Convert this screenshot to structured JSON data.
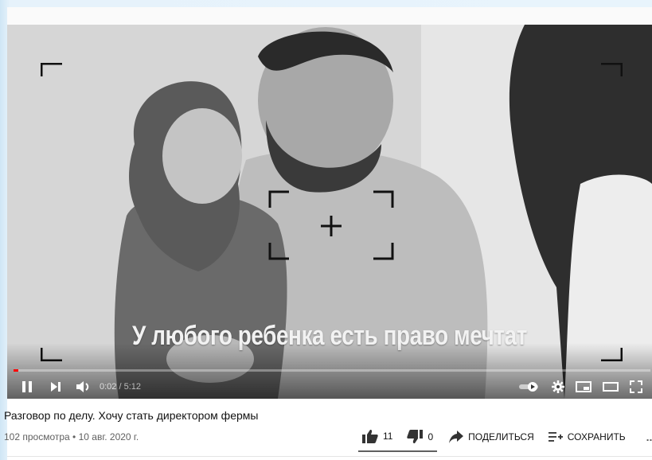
{
  "video": {
    "subtitle": "У любого ребенка есть право мечтат",
    "time_current": "0:02",
    "time_separator": " / ",
    "time_duration": "5:12",
    "progress": 0.006
  },
  "controls": {
    "play_state": "playing",
    "autoplay_on": true
  },
  "info": {
    "title": "Разговор по делу. Хочу стать директором фермы",
    "views": "102 просмотра",
    "separator": " • ",
    "date": "10 авг. 2020 г."
  },
  "actions": {
    "like_count": "11",
    "dislike_count": "0",
    "share_label": "ПОДЕЛИТЬСЯ",
    "save_label": "СОХРАНИТЬ",
    "more_label": "..."
  },
  "colors": {
    "progress_played": "#ff0000",
    "text_primary": "#111111",
    "text_secondary": "#606060"
  }
}
